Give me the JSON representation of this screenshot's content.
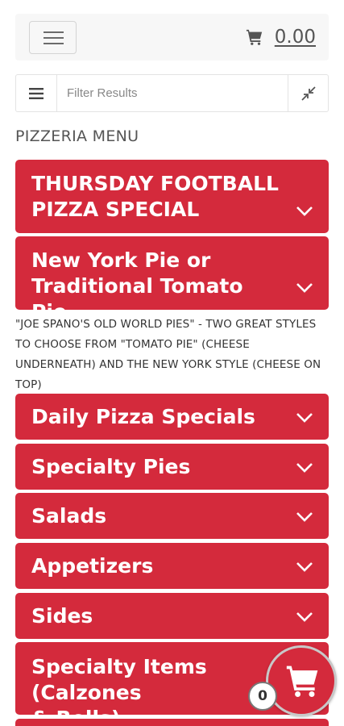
{
  "header": {
    "cart_total": "0.00"
  },
  "filter": {
    "placeholder": "Filter Results"
  },
  "menu": {
    "title": "PIZZERIA MENU",
    "categories": [
      {
        "label": "THURSDAY FOOTBALL\nPIZZA SPECIAL"
      },
      {
        "label": "New York Pie or\nTraditional Tomato Pie"
      },
      {
        "label": "Daily Pizza Specials"
      },
      {
        "label": "Specialty Pies"
      },
      {
        "label": "Salads"
      },
      {
        "label": "Appetizers"
      },
      {
        "label": "Sides"
      },
      {
        "label": "Specialty Items (Calzones\n& Rolls)"
      }
    ],
    "new_york_description": "\"JOE SPANO'S OLD WORLD PIES\" - TWO GREAT STYLES TO CHOOSE FROM \"TOMATO PIE\" (CHEESE UNDERNEATH) AND THE NEW YORK STYLE (CHEESE ON TOP)"
  },
  "floating_cart": {
    "count": "0"
  },
  "colors": {
    "accent": "#d42a3c",
    "text": "#333333"
  },
  "icons": [
    "hamburger-icon",
    "cart-icon",
    "list-icon",
    "collapse-icon",
    "chevron-down-icon",
    "shopping-cart-icon"
  ]
}
